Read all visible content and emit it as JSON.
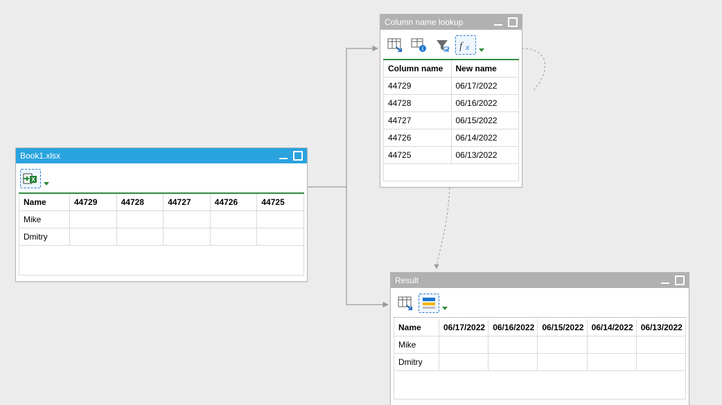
{
  "nodes": {
    "source": {
      "title": "Book1.xlsx",
      "headers": [
        "Name",
        "44729",
        "44728",
        "44727",
        "44726",
        "44725"
      ],
      "rows": [
        [
          "Mike",
          "",
          "",
          "",
          "",
          ""
        ],
        [
          "Dmitry",
          "",
          "",
          "",
          "",
          ""
        ]
      ]
    },
    "lookup": {
      "title": "Column name lookup",
      "headers": [
        "Column name",
        "New name"
      ],
      "rows": [
        [
          "44729",
          "06/17/2022"
        ],
        [
          "44728",
          "06/16/2022"
        ],
        [
          "44727",
          "06/15/2022"
        ],
        [
          "44726",
          "06/14/2022"
        ],
        [
          "44725",
          "06/13/2022"
        ]
      ]
    },
    "result": {
      "title": "Result",
      "headers": [
        "Name",
        "06/17/2022",
        "06/16/2022",
        "06/15/2022",
        "06/14/2022",
        "06/13/2022"
      ],
      "rows": [
        [
          "Mike",
          "",
          "",
          "",
          "",
          ""
        ],
        [
          "Dmitry",
          "",
          "",
          "",
          "",
          ""
        ]
      ]
    }
  },
  "icons": {
    "import_excel": "import-excel-icon",
    "table_arrow": "table-arrow-icon",
    "table_info": "table-info-icon",
    "filter": "filter-icon",
    "fx": "fx-icon",
    "rename": "rename-columns-icon"
  }
}
